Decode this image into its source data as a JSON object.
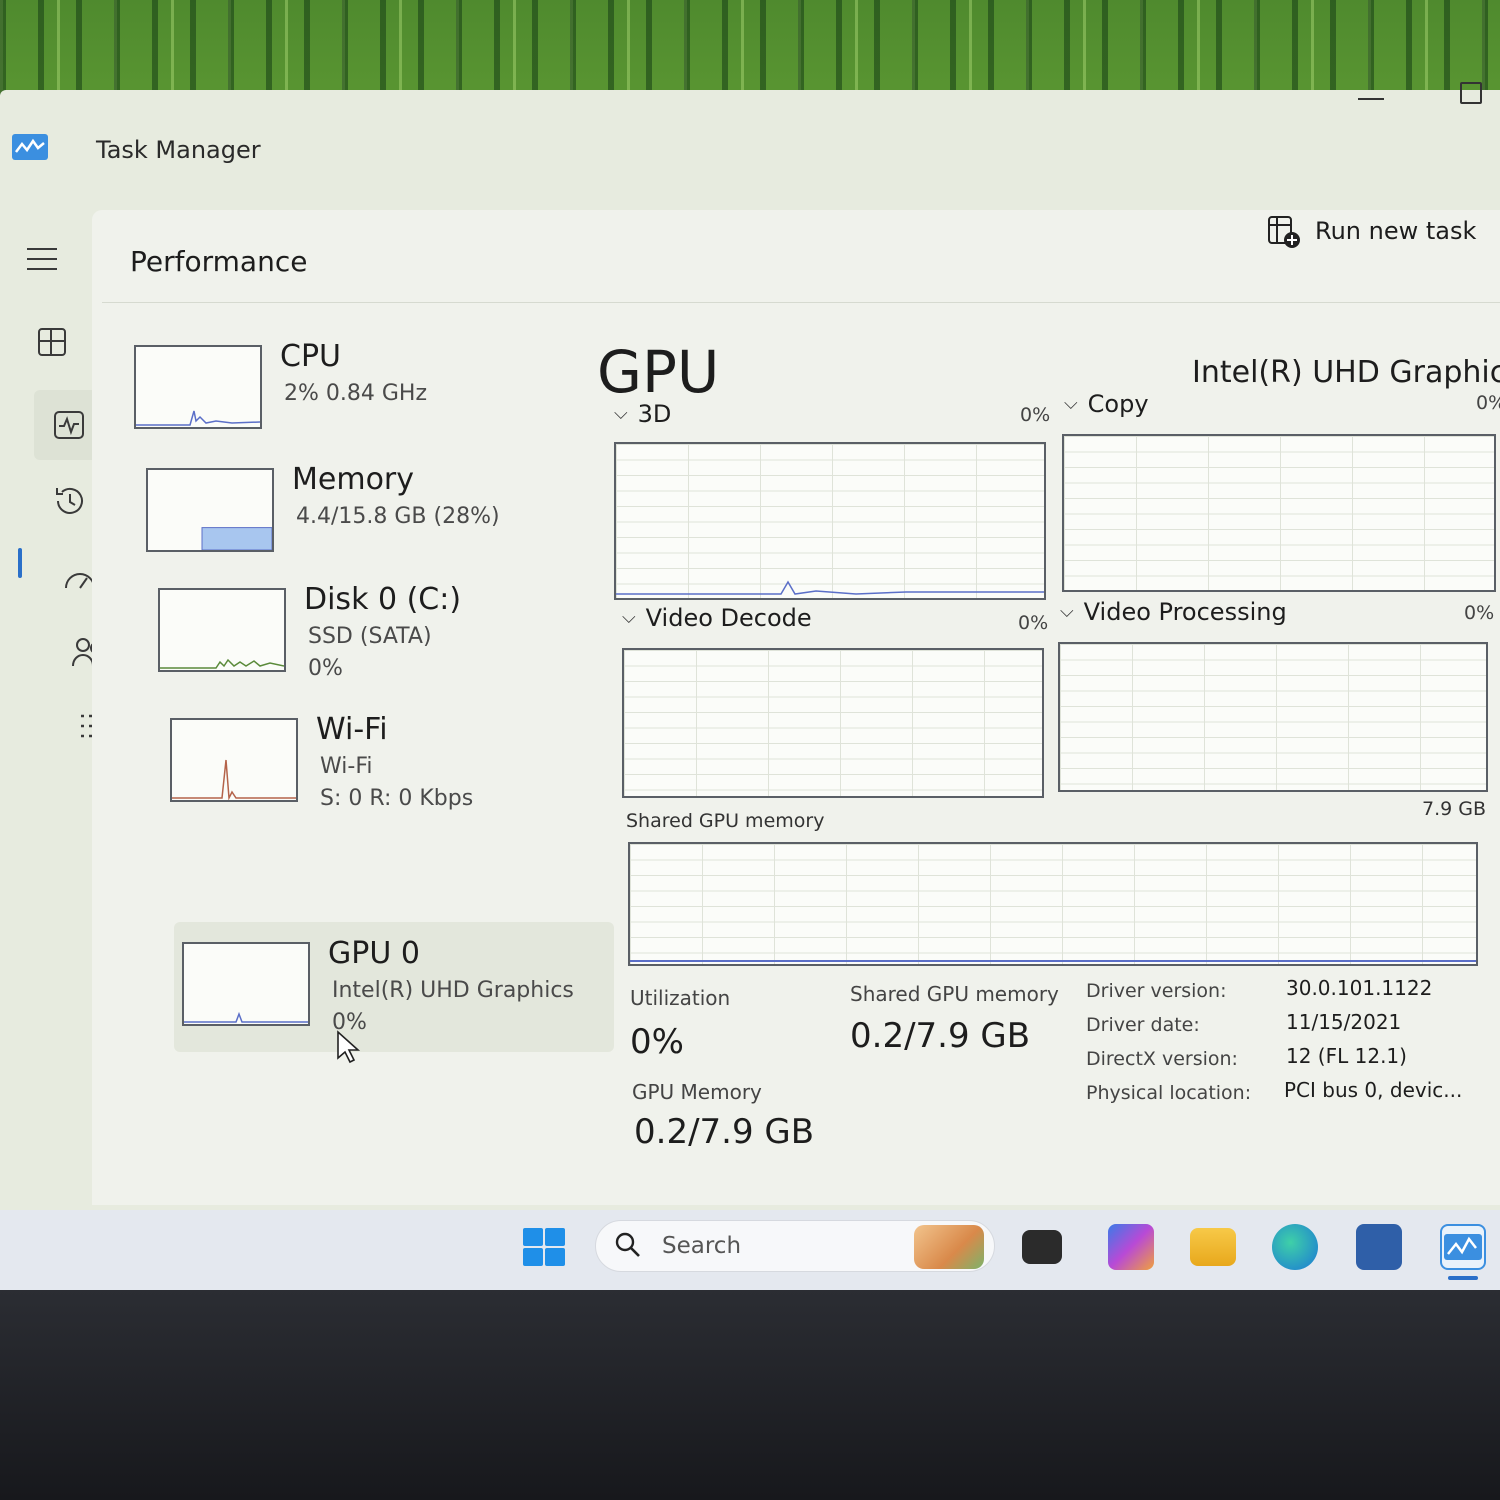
{
  "window": {
    "title": "Task Manager"
  },
  "header": {
    "page_title": "Performance",
    "run_new_task_label": "Run new task"
  },
  "devices": [
    {
      "name": "CPU",
      "line1": "2%  0.84 GHz",
      "line2": ""
    },
    {
      "name": "Memory",
      "line1": "4.4/15.8 GB (28%)",
      "line2": ""
    },
    {
      "name": "Disk 0 (C:)",
      "line1": "SSD (SATA)",
      "line2": "0%"
    },
    {
      "name": "Wi-Fi",
      "line1": "Wi-Fi",
      "line2": "S: 0  R: 0 Kbps"
    },
    {
      "name": "GPU 0",
      "line1": "Intel(R) UHD Graphics",
      "line2": "0%"
    }
  ],
  "memory_usage_fraction": 0.28,
  "gpu": {
    "title": "GPU",
    "model": "Intel(R) UHD Graphic",
    "engines": [
      {
        "label": "3D",
        "percent": "0%"
      },
      {
        "label": "Copy",
        "percent": "0%"
      },
      {
        "label": "Video Decode",
        "percent": "0%"
      },
      {
        "label": "Video Processing",
        "percent": "0%"
      }
    ],
    "shared_memory_graph": {
      "label": "Shared GPU memory",
      "max": "7.9 GB"
    },
    "stats": {
      "utilization_label": "Utilization",
      "utilization_value": "0%",
      "shared_label": "Shared GPU memory",
      "shared_value": "0.2/7.9 GB",
      "gpu_memory_label": "GPU Memory",
      "gpu_memory_value": "0.2/7.9 GB"
    },
    "info": [
      {
        "key": "Driver version:",
        "value": "30.0.101.1122"
      },
      {
        "key": "Driver date:",
        "value": "11/15/2021"
      },
      {
        "key": "DirectX version:",
        "value": "12 (FL 12.1)"
      },
      {
        "key": "Physical location:",
        "value": "PCI bus 0, devic..."
      }
    ]
  },
  "taskbar": {
    "search_placeholder": "Search"
  },
  "colors": {
    "accent": "#2a6fc9",
    "graph_line": "#5b6fc8",
    "memory_fill": "#a8c6ef"
  }
}
